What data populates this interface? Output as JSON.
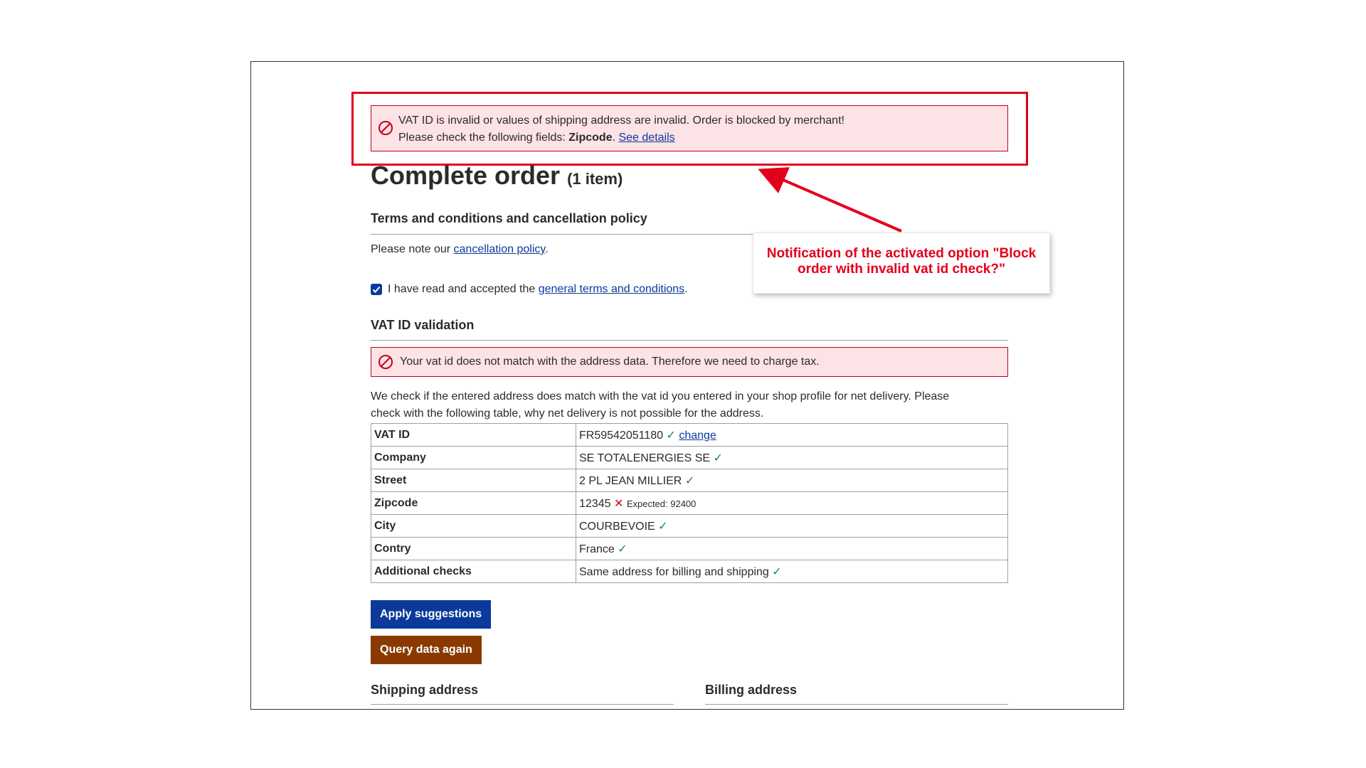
{
  "alert_top": {
    "line1": "VAT ID is invalid or values of shipping address are invalid. Order is blocked by merchant!",
    "line2_prefix": "Please check the following fields: ",
    "line2_field": "Zipcode",
    "line2_sep": ". ",
    "link": "See details"
  },
  "page": {
    "title": "Complete order",
    "item_count": "(1 item)"
  },
  "terms": {
    "heading": "Terms and conditions and cancellation policy",
    "note_prefix": "Please note our ",
    "note_link": "cancellation policy",
    "note_suffix": ".",
    "accept_prefix": "I have read and accepted the ",
    "accept_link": "general terms and conditions",
    "accept_suffix": ".",
    "accepted": true
  },
  "vat": {
    "heading": "VAT ID validation",
    "error": "Your vat id does not match with the address data. Therefore we need to charge tax.",
    "desc_line1": "We check if the entered address does match with the vat id you entered in your shop profile for net delivery. Please",
    "desc_line2": "check with the following table, why net delivery is not possible for the address.",
    "rows": [
      {
        "label": "VAT ID",
        "value": "FR59542051180",
        "status": "ok",
        "link": "change"
      },
      {
        "label": "Company",
        "value": "SE TOTALENERGIES SE",
        "status": "ok"
      },
      {
        "label": "Street",
        "value": "2 PL JEAN MILLIER",
        "status": "ok"
      },
      {
        "label": "Zipcode",
        "value": "12345",
        "status": "error",
        "expected": "Expected: 92400"
      },
      {
        "label": "City",
        "value": "COURBEVOIE",
        "status": "ok"
      },
      {
        "label": "Contry",
        "value": "France",
        "status": "ok"
      },
      {
        "label": "Additional checks",
        "value": "Same address for billing and shipping",
        "status": "ok"
      }
    ],
    "apply_button": "Apply suggestions",
    "query_button": "Query data again"
  },
  "addresses": {
    "shipping_heading": "Shipping address",
    "billing_heading": "Billing address"
  },
  "annotation": {
    "line1": "Notification of the activated option \"Block",
    "line2": "order with invalid vat id check?\"",
    "color": "#e3001b"
  },
  "icons": {
    "alert": "prohibited-icon",
    "ok": "checkmark-icon",
    "error": "cross-icon",
    "checkbox": "checkbox-checked-icon"
  }
}
